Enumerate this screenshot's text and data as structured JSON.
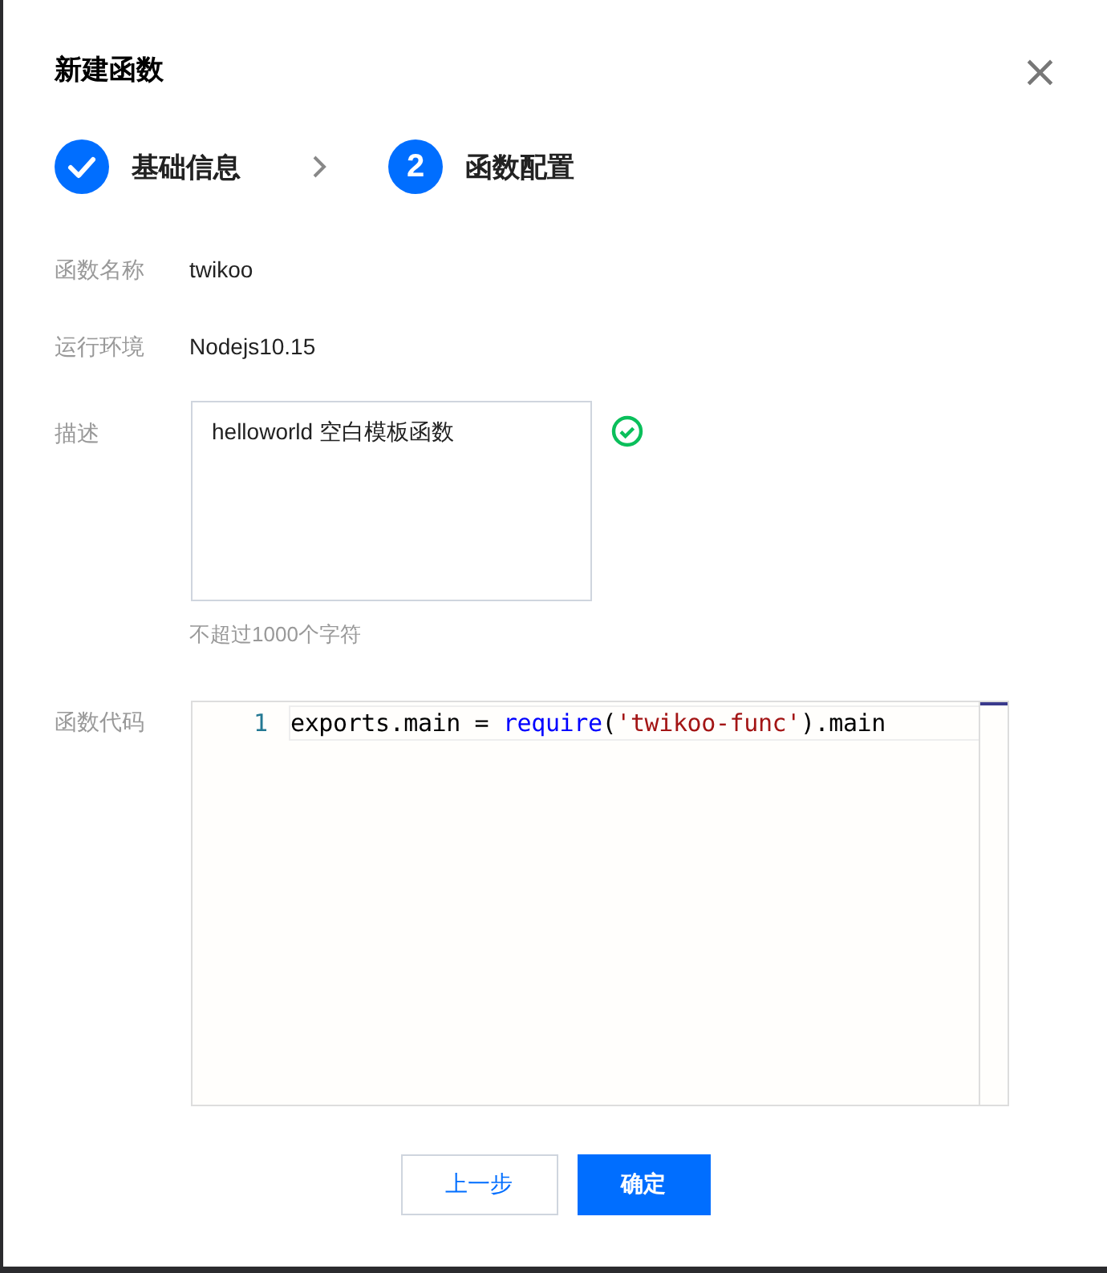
{
  "dialog": {
    "title": "新建函数",
    "close": "×"
  },
  "steps": [
    {
      "label": "基础信息",
      "done": true
    },
    {
      "number": "2",
      "label": "函数配置",
      "done": false
    }
  ],
  "fields": [
    {
      "label": "函数名称",
      "kind": "text",
      "value": "twikoo"
    },
    {
      "label": "运行环境",
      "kind": "text",
      "value": "Nodejs10.15"
    },
    {
      "label": "描述",
      "kind": "textarea",
      "value": "helloworld 空白模板函数",
      "valid": true,
      "hint": "不超过1000个字符"
    },
    {
      "label": "函数代码",
      "kind": "code",
      "lines": [
        {
          "number": "1",
          "tokens": [
            {
              "kind": "plain",
              "text": "exports.main = "
            },
            {
              "kind": "keyword",
              "text": "require"
            },
            {
              "kind": "plain",
              "text": "("
            },
            {
              "kind": "string",
              "text": "'twikoo-func'"
            },
            {
              "kind": "plain",
              "text": ").main"
            }
          ]
        }
      ]
    }
  ],
  "buttons": [
    {
      "label": "上一步",
      "kind": "secondary"
    },
    {
      "label": "确定",
      "kind": "primary"
    }
  ]
}
